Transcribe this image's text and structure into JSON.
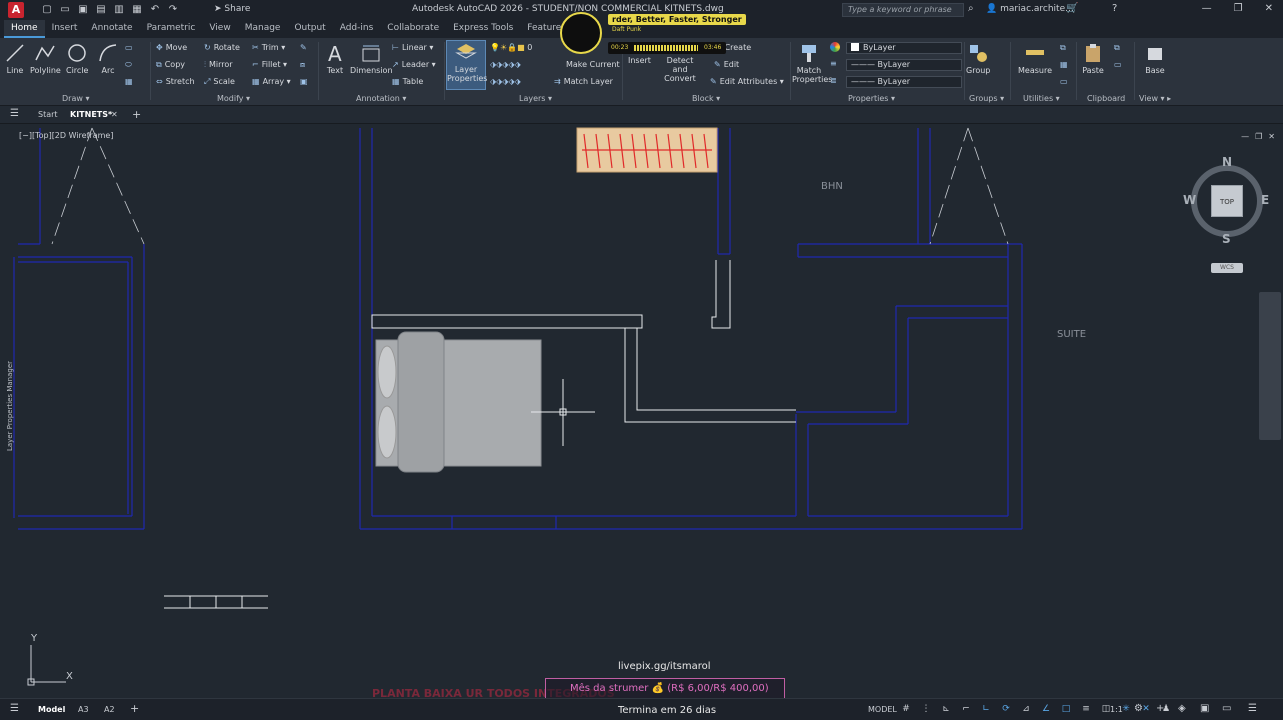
{
  "app": {
    "title": "Autodesk AutoCAD 2026 - STUDENT/NON COMMERCIAL    KITNETS.dwg",
    "logo_letter": "A",
    "share": "Share",
    "search_placeholder": "Type a keyword or phrase",
    "user": "mariac.archite..."
  },
  "menu_tabs": [
    "Home",
    "Insert",
    "Annotate",
    "Parametric",
    "View",
    "Manage",
    "Output",
    "Add-ins",
    "Collaborate",
    "Express Tools",
    "Featured Apps"
  ],
  "ribbon": {
    "draw": {
      "title": "Draw",
      "line": "Line",
      "polyline": "Polyline",
      "circle": "Circle",
      "arc": "Arc"
    },
    "modify": {
      "title": "Modify",
      "move": "Move",
      "rotate": "Rotate",
      "trim": "Trim",
      "copy": "Copy",
      "mirror": "Mirror",
      "fillet": "Fillet",
      "stretch": "Stretch",
      "scale": "Scale",
      "array": "Array"
    },
    "annotation": {
      "title": "Annotation",
      "text": "Text",
      "dimension": "Dimension",
      "linear": "Linear",
      "leader": "Leader",
      "table": "Table"
    },
    "layers": {
      "title": "Layers",
      "layer_properties": "Layer Properties",
      "layer_value": "0",
      "make_current": "Make Current",
      "match_layer": "Match Layer"
    },
    "block": {
      "title": "Block",
      "insert": "Insert",
      "detect_convert": "Detect and Convert",
      "create": "Create",
      "edit": "Edit",
      "edit_attributes": "Edit Attributes"
    },
    "properties": {
      "title": "Properties",
      "match_properties": "Match Properties",
      "color": "ByLayer",
      "linetype": "ByLayer",
      "lineweight": "ByLayer"
    },
    "groups": {
      "title": "Groups",
      "group": "Group"
    },
    "utilities": {
      "title": "Utilities",
      "measure": "Measure"
    },
    "clipboard": {
      "title": "Clipboard",
      "paste": "Paste"
    },
    "view": {
      "title": "View",
      "base": "Base"
    }
  },
  "music": {
    "title": "rder, Better, Faster, Stronger",
    "artist": "Daft Punk",
    "elapsed": "00:23",
    "total": "03:46"
  },
  "file_tabs": {
    "start": "Start",
    "current": "KITNETS*"
  },
  "viewport": {
    "label": "[−][Top][2D Wireframe]",
    "side_panel": "Layer Properties Manager",
    "rooms": [
      "BHN",
      "SUITE"
    ],
    "viewcube": {
      "n": "N",
      "s": "S",
      "e": "E",
      "w": "W",
      "top": "TOP",
      "wcs": "WCS"
    },
    "ucs_y": "Y",
    "ucs_x": "X"
  },
  "overlay": {
    "livepix": "livepix.gg/itsmarol",
    "goal": "Mês da strumer 💰 (R$ 6,00/R$ 400,00)",
    "bg_text": "PLANTA BAIXA UR  TODOS INTEGRADOS",
    "ends": "Termina em 26 dias"
  },
  "status": {
    "model": "Model",
    "a3": "A3",
    "a2": "A2",
    "mode": "MODEL",
    "scale": "1:1"
  }
}
